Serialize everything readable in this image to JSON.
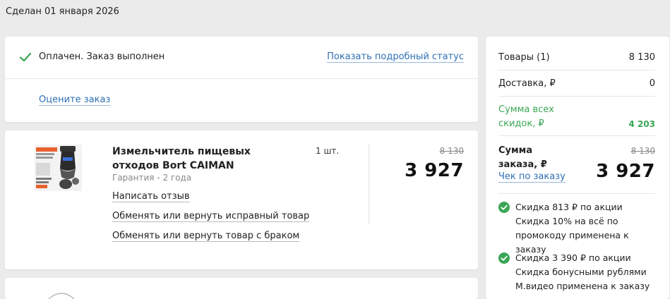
{
  "order": {
    "date_text": "Сделан 01 января 2026"
  },
  "status": {
    "icon": "check-icon",
    "text": "Оплачен. Заказ выполнен",
    "details_link": "Показать подробный статус",
    "rate_link": "Оцените заказ"
  },
  "product": {
    "name": "Измельчитель пищевых отходов Bort CAIMAN",
    "warranty": "Гарантия - 2 года",
    "quantity": "1 шт.",
    "old_price": "8 130",
    "price": "3 927",
    "actions": {
      "review": "Написать отзыв",
      "return_good": "Обменять или вернуть исправный товар",
      "return_defect": "Обменять или вернуть товар с браком"
    }
  },
  "summary": {
    "goods_label": "Товары (1)",
    "goods_value": "8 130",
    "delivery_label": "Доставка, ₽",
    "delivery_value": "0",
    "discounts_label": "Сумма всех скидок, ₽",
    "discounts_value": "4 203",
    "total_label": "Сумма заказа, ₽",
    "total_old": "8 130",
    "total_new": "3 927",
    "receipt_link": "Чек по заказу",
    "discount_notes": [
      "Скидка 813 ₽ по акции Скидка 10% на всё по промокоду применена к заказу",
      "Скидка 3 390 ₽ по акции Скидка бонусными рублями М.видео применена к заказу"
    ]
  },
  "colors": {
    "accent_link": "#2f6fb3",
    "success_green": "#3aa655"
  }
}
